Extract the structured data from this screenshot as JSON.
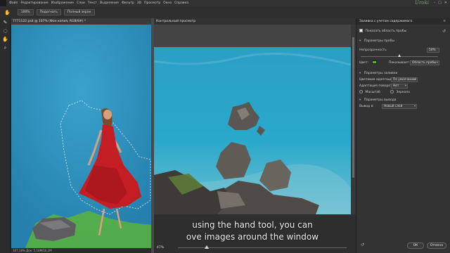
{
  "menu": {
    "items": [
      "Файл",
      "Редактирование",
      "Изображение",
      "Слои",
      "Текст",
      "Выделение",
      "Фильтр",
      "3D",
      "Просмотр",
      "Окно",
      "Справка"
    ],
    "watermark": "Uroki"
  },
  "options_bar": {
    "zoom_label": "100%",
    "fit_label": "Подогнать",
    "fullscreen_label": "Полный экран"
  },
  "document": {
    "tab_title": "7771122.psd @ 107% (Фон копия, RGB/8#) *",
    "status": "107,18%   Док: 5,18М/16,1М"
  },
  "preview": {
    "header": "Контрольный просмотр",
    "caption_line1": "using the hand tool, you can",
    "caption_line2": "ove images around the window",
    "zoom_value": "47%",
    "zoom_level": 0.17
  },
  "panel": {
    "title": "Заливка с учетом содержимого",
    "show_sample_area": "Показать область пробы",
    "sample_params_title": "Параметры пробы",
    "opacity_label": "Непрозрачность",
    "opacity_value": "50%",
    "opacity_level": 0.5,
    "color_label": "Цвет:",
    "color_value": "#58b42a",
    "indicate_label": "Показывает:",
    "indicate_value": "Область пробы",
    "fill_params_title": "Параметры заливки",
    "color_adapt_label": "Цветовая адаптация:",
    "color_adapt_value": "По умолчанию",
    "rotation_adapt_label": "Адаптация поворота:",
    "rotation_adapt_value": "Нет",
    "scale_label": "Масштаб",
    "mirror_label": "Зеркало",
    "output_params_title": "Параметры вывода",
    "output_to_label": "Вывод в:",
    "output_to_value": "Новый слой",
    "ok_label": "ОК",
    "cancel_label": "Отмена"
  },
  "colors": {
    "app_bg": "#2b2b2b",
    "sky": "#2a93be",
    "dress": "#c41e24",
    "sample_color": "#58b42a"
  }
}
